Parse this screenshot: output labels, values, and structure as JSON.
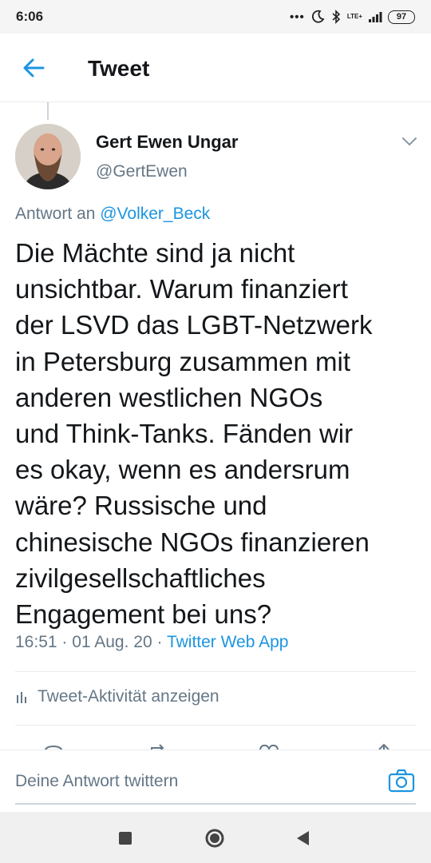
{
  "status_bar": {
    "time": "6:06",
    "network": "LTE+",
    "battery": "97"
  },
  "app_bar": {
    "title": "Tweet"
  },
  "tweet": {
    "author_name": "Gert Ewen Ungar",
    "author_handle": "@GertEwen",
    "reply_prefix": "Antwort an",
    "reply_mention": "@Volker_Beck",
    "text": "Die Mächte sind ja nicht\nunsichtbar. Warum finanziert\nder LSVD das LGBT-Netzwerk\nin Petersburg zusammen mit\nanderen westlichen NGOs\nund Think-Tanks. Fänden wir\nes okay, wenn es andersrum\nwäre? Russische und\nchinesische NGOs finanzieren\nzivilgesellschaftliches\nEngagement bei uns?",
    "timestamp": "16:51 · 01 Aug. 20 ·",
    "source": "Twitter Web App",
    "activity_label": "Tweet-Aktivität anzeigen"
  },
  "reply_bar": {
    "placeholder": "Deine Antwort twittern"
  },
  "colors": {
    "accent": "#1b95e0",
    "secondary_text": "#657786",
    "divider": "#e6ecf0"
  },
  "icons": [
    "back-arrow-icon",
    "chevron-down-icon",
    "bar-chart-icon",
    "reply-icon",
    "retweet-icon",
    "like-icon",
    "share-icon",
    "camera-icon",
    "moon-icon",
    "bluetooth-icon",
    "signal-icon"
  ]
}
